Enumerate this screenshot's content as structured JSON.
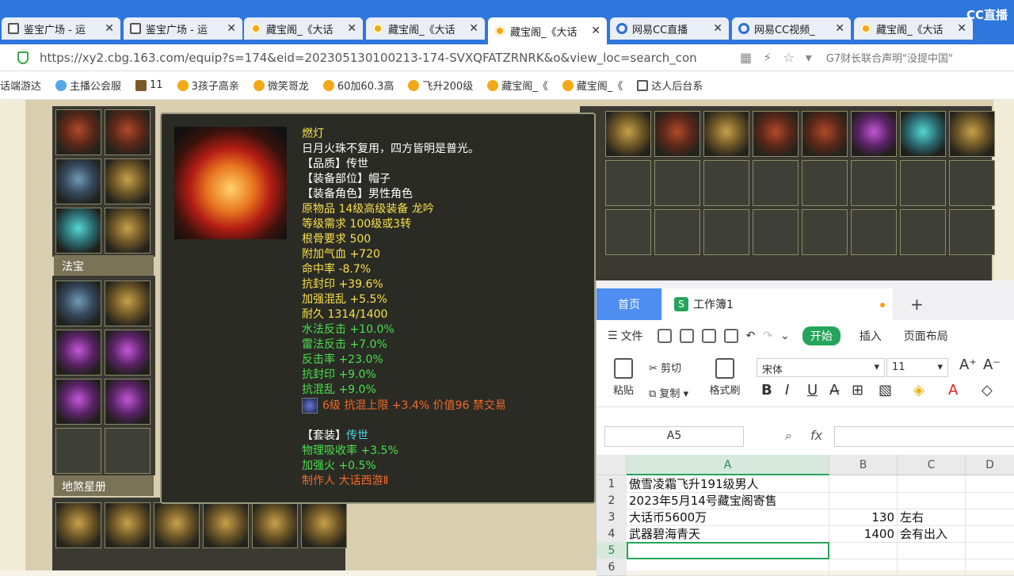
{
  "tabs": [
    {
      "icon": "doc",
      "label": "鉴宝广场 - 运",
      "active": false
    },
    {
      "icon": "doc",
      "label": "鉴宝广场 - 运",
      "active": false
    },
    {
      "icon": "star",
      "label": "藏宝阁_《大话",
      "active": false
    },
    {
      "icon": "star",
      "label": "藏宝阁_《大话",
      "active": false
    },
    {
      "icon": "star",
      "label": "藏宝阁_《大话",
      "active": true
    },
    {
      "icon": "cc",
      "label": "网易CC直播",
      "active": false
    },
    {
      "icon": "cc",
      "label": "网易CC视频_",
      "active": false
    },
    {
      "icon": "star",
      "label": "藏宝阁_《大话",
      "active": false
    }
  ],
  "cc_logo": "CC直播",
  "address": {
    "url": "https://xy2.cbg.163.com/equip?s=174&eid=202305130100213-174-SVXQFATZRNRK&o&view_loc=search_con",
    "notice": "G7财长联合声明\"没提中国\""
  },
  "bookmarks": [
    {
      "label": "话端游达",
      "icon": "none"
    },
    {
      "label": "主播公会服",
      "icon": "blue"
    },
    {
      "label": "11",
      "icon": "img"
    },
    {
      "label": "3孩子高亲",
      "icon": "star"
    },
    {
      "label": "微笑哥龙",
      "icon": "star"
    },
    {
      "label": "60加60.3高",
      "icon": "star"
    },
    {
      "label": "飞升200级",
      "icon": "star"
    },
    {
      "label": "藏宝阁_《",
      "icon": "star"
    },
    {
      "label": "藏宝阁_《",
      "icon": "star"
    },
    {
      "label": "达人后台系",
      "icon": "docb"
    }
  ],
  "game": {
    "section_fabao": "法宝",
    "section_disha": "地煞星册"
  },
  "tooltip": {
    "lines": [
      {
        "text": "燃灯",
        "color": "yellow"
      },
      {
        "text": "日月火珠不复用，四方皆明是普光。",
        "color": "white"
      },
      {
        "text": "【品质】传世",
        "color": "white"
      },
      {
        "text": "【装备部位】帽子",
        "color": "white"
      },
      {
        "text": "【装备角色】男性角色",
        "color": "white"
      },
      {
        "text": "原物品 14级高级装备 龙吟",
        "color": "yellow"
      },
      {
        "text": "等级需求 100级或3转",
        "color": "yellow"
      },
      {
        "text": "根骨要求 500",
        "color": "yellow"
      },
      {
        "text": "附加气血 +720",
        "color": "yellow"
      },
      {
        "text": "命中率 -8.7%",
        "color": "yellow"
      },
      {
        "text": "抗封印 +39.6%",
        "color": "yellow"
      },
      {
        "text": "加强混乱 +5.5%",
        "color": "yellow"
      },
      {
        "text": "耐久 1314/1400",
        "color": "yellow"
      },
      {
        "text": "水法反击 +10.0%",
        "color": "green"
      },
      {
        "text": "雷法反击 +7.0%",
        "color": "green"
      },
      {
        "text": "反击率 +23.0%",
        "color": "green"
      },
      {
        "text": "抗封印 +9.0%",
        "color": "green"
      },
      {
        "text": "抗混乱 +9.0%",
        "color": "green"
      }
    ],
    "gem_line": "6级 抗混上限 +3.4% 价值96 禁交易",
    "set_label": "【套装】",
    "set_name": "传世",
    "set_lines": [
      {
        "text": "物理吸收率 +3.5%",
        "color": "green"
      },
      {
        "text": "加强火 +0.5%",
        "color": "green"
      }
    ],
    "maker": "制作人 大话西游Ⅱ"
  },
  "wps": {
    "home_tab": "首页",
    "book_tab": "工作簿1",
    "menu": {
      "file": "文件",
      "start": "开始",
      "insert": "插入",
      "layout": "页面布局"
    },
    "ribbon": {
      "paste": "粘贴",
      "cut": "剪切",
      "copy": "复制",
      "format_painter": "格式刷",
      "font": "宋体",
      "size": "11"
    },
    "namebox": "A5",
    "fx": "fx",
    "columns": [
      "A",
      "B",
      "C",
      "D"
    ],
    "rows": [
      {
        "n": "1",
        "a": "傲雪凌霜飞升191级男人",
        "b": "",
        "c": ""
      },
      {
        "n": "2",
        "a": "2023年5月14号藏宝阁寄售",
        "b": "",
        "c": ""
      },
      {
        "n": "3",
        "a": "大话币5600万",
        "b": "130",
        "c": "左右"
      },
      {
        "n": "4",
        "a": "武器碧海青天",
        "b": "1400",
        "c": "会有出入"
      },
      {
        "n": "5",
        "a": "",
        "b": "",
        "c": ""
      },
      {
        "n": "6",
        "a": "",
        "b": "",
        "c": ""
      }
    ]
  }
}
